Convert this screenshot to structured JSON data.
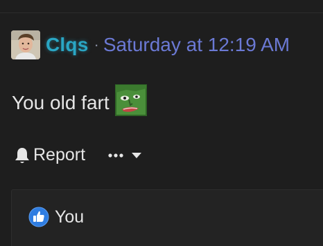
{
  "post": {
    "username": "Clqs",
    "separator": "·",
    "timestamp": "Saturday at 12:19 AM",
    "message": "You old fart"
  },
  "actions": {
    "report_label": "Report"
  },
  "reactions": {
    "label": "You"
  },
  "colors": {
    "background": "#1e1e1e",
    "username": "#2aa6c4",
    "timestamp": "#6b79d4",
    "text": "#e6e6e6",
    "like_blue": "#2f7de1"
  },
  "icons": {
    "avatar": "user-avatar",
    "emoji": "green-face-emoji",
    "report": "bell-icon",
    "more": "ellipsis-icon",
    "dropdown": "caret-down-icon",
    "like": "thumbs-up-icon"
  }
}
